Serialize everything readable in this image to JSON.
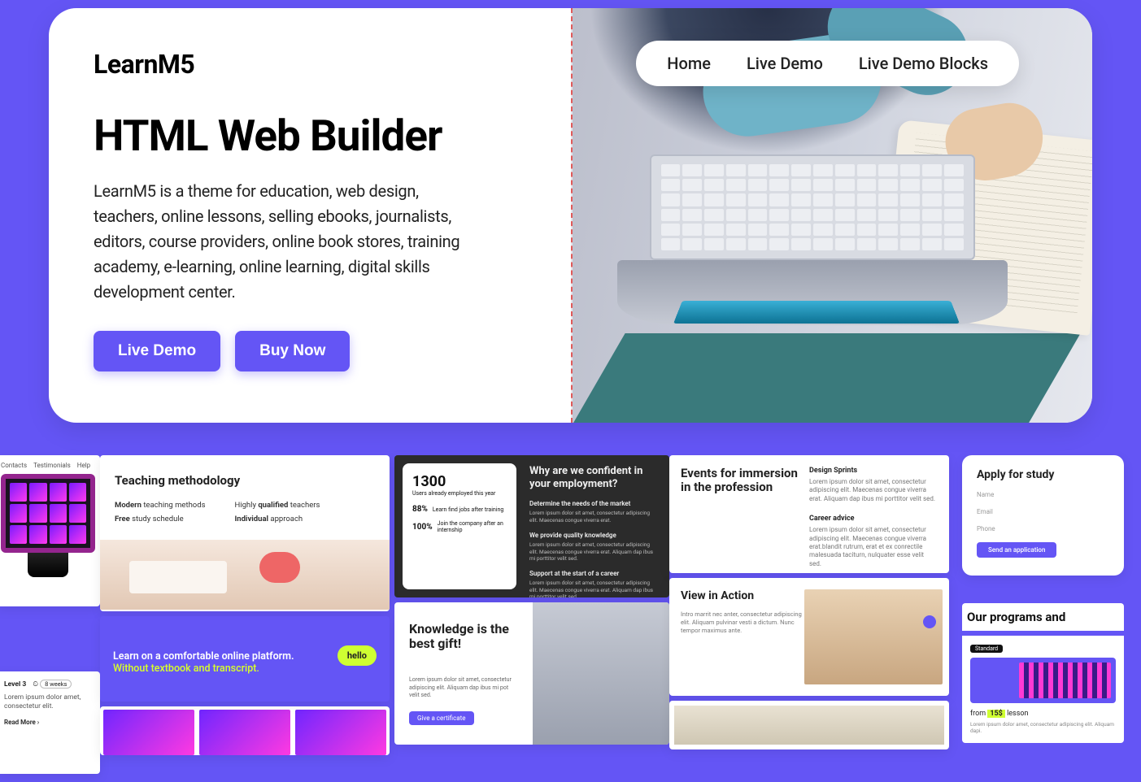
{
  "brand": "LearnM5",
  "nav": {
    "home": "Home",
    "demo": "Live Demo",
    "blocks": "Live Demo Blocks"
  },
  "hero": {
    "headline": "HTML Web Builder",
    "desc": "LearnM5 is a theme for education, web design, teachers, online lessons, selling ebooks, journalists, editors, course providers, online book stores, training academy, e-learning, online learning, digital skills development center.",
    "btn_demo": "Live Demo",
    "btn_buy": "Buy Now"
  },
  "cA": {
    "t1": "Contacts",
    "t2": "Testimonials",
    "t3": "Help"
  },
  "level3": {
    "title": "Level 3",
    "badge": "8 weeks",
    "body": "Lorem ipsum dolor amet, consectetur elit.",
    "read": "Read More ›"
  },
  "method": {
    "title": "Teaching methodology",
    "a1": "Modern teaching methods",
    "a2": "Free study schedule",
    "b1": "Highly qualified teachers",
    "b2": "Individual approach"
  },
  "learn": {
    "l1": "Learn on a comfortable online platform.",
    "l2": "Without textbook and transcript.",
    "badge": "hello"
  },
  "stats": {
    "big": "1300",
    "sub": "Users already employed this year",
    "r1v": "88%",
    "r1t": "Learn find jobs after training",
    "r2v": "100%",
    "r2t": "Join the company after an internship"
  },
  "why": {
    "title": "Why are we confident in your employment?",
    "h1": "Determine the needs of the market",
    "p1": "Lorem ipsum dolor sit amet, consectetur adipiscing elit. Maecenas congue viverra erat.",
    "h2": "We provide quality knowledge",
    "p2": "Lorem ipsum dolor sit amet, consectetur adipiscing elit. Maecenas congue viverra erat. Aliquam dap ibus mi porttitor velit sed.",
    "h3": "Support at the start of a career",
    "p3": "Lorem ipsum dolor sit amet, consectetur adipiscing elit. Maecenas congue viverra erat. Aliquam dap ibus mi porttitor velit sed."
  },
  "gift": {
    "title": "Knowledge is the best gift!",
    "p": "Lorem ipsum dolor sit amet, consectetur adipiscing elit. Aliquam dap ibus mi pot velit sed.",
    "btn": "Give a certificate"
  },
  "events": {
    "title": "Events for immersion in the profession",
    "s1": "Design Sprints",
    "p1": "Lorem ipsum dolor sit amet, consectetur adipiscing elit. Maecenas congue viverra erat. Aliquam dap ibus mi porttitor velit sed.",
    "s2": "Career advice",
    "p2": "Lorem ipsum dolor sit amet, consectetur adipiscing elit. Maecenas congue viverra erat.blandit rutrum, erat et ex conrectile malesuada taciturn, nulquater esse velit sed."
  },
  "view": {
    "title": "View in Action",
    "p": "Intro marrit nec anter, consectetur adipiscing elit. Aliquam pulvinar vesti a dictum. Nunc tempor maximus ante."
  },
  "apply": {
    "title": "Apply for study",
    "f1": "Name",
    "f2": "Email",
    "f3": "Phone",
    "btn": "Send an application"
  },
  "programs": {
    "title": "Our programs and",
    "tag": "Standard",
    "from": "from ",
    "price": "15$",
    "unit": "lesson",
    "sm": "Lorem ipsum dolor amet, consectetur adipiscing elit. Aliquam dapi."
  }
}
